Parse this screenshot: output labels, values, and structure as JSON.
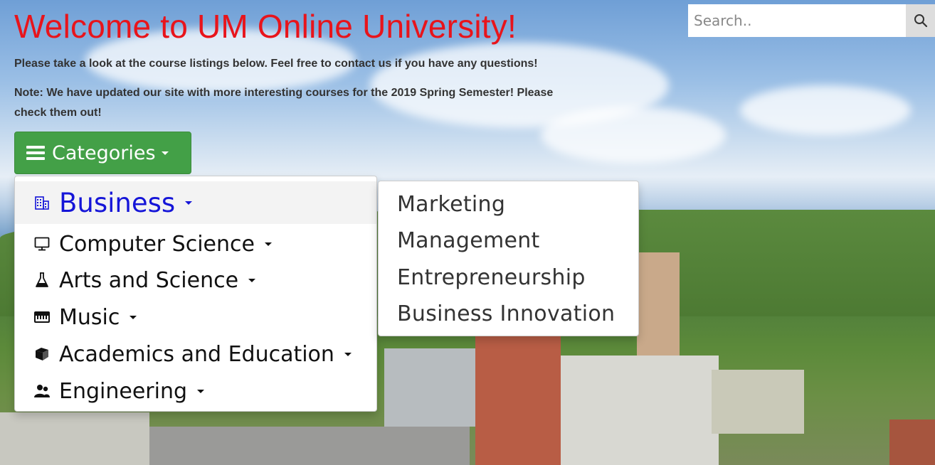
{
  "page": {
    "title": "Welcome to UM Online University!",
    "lead": "Please take a look at the course listings below. Feel free to contact us if you have any questions!",
    "note": "Note: We have updated our site with more interesting courses for the 2019 Spring Semester! Please check them out!"
  },
  "search": {
    "placeholder": "Search..",
    "value": "",
    "icon": "search-icon"
  },
  "categories_button": {
    "label": "Categories",
    "icon": "hamburger-icon",
    "color": "#43a047"
  },
  "menu": {
    "items": [
      {
        "label": "Business",
        "icon": "building-icon",
        "active": true
      },
      {
        "label": "Computer Science",
        "icon": "monitor-icon"
      },
      {
        "label": "Arts and Science",
        "icon": "flask-icon"
      },
      {
        "label": "Music",
        "icon": "piano-icon"
      },
      {
        "label": "Academics and Education",
        "icon": "books-icon"
      },
      {
        "label": "Engineering",
        "icon": "people-icon"
      }
    ],
    "active_color": "#1515d8"
  },
  "submenu": {
    "items": [
      {
        "label": "Marketing"
      },
      {
        "label": "Management"
      },
      {
        "label": "Entrepreneurship"
      },
      {
        "label": "Business Innovation"
      }
    ]
  },
  "colors": {
    "title": "#e8141b",
    "accent": "#43a047"
  }
}
